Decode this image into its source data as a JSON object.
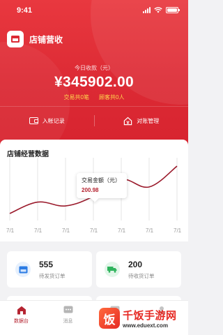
{
  "status_bar": {
    "time": "9:41"
  },
  "header": {
    "store_title": "店铺营收"
  },
  "revenue": {
    "label": "今日收款（元）",
    "amount": "¥345902.00",
    "transactions": "交易共0笔",
    "customers": "顾客共0人"
  },
  "actions": {
    "entry_records": "入帐记录",
    "reconcile": "对账管理"
  },
  "chart": {
    "title": "店铺经营数据",
    "tooltip_label": "交易金额（元）",
    "tooltip_value": "200.98",
    "x_labels": [
      "7/1",
      "7/1",
      "7/1",
      "7/1",
      "7/1",
      "7/1",
      "7/1"
    ]
  },
  "chart_data": {
    "type": "line",
    "title": "店铺经营数据",
    "categories": [
      "7/1",
      "7/1",
      "7/1",
      "7/1",
      "7/1",
      "7/1",
      "7/1"
    ],
    "values": [
      30,
      90,
      70,
      120,
      210,
      170,
      280
    ],
    "highlight": {
      "index": 3,
      "label": "交易金额（元）",
      "value": "200.98"
    },
    "grid": true,
    "line_color": "#9b1b2c"
  },
  "stats": [
    {
      "value": "555",
      "label": "待发货订单",
      "icon": "storefront-icon",
      "color": "#2a7be4",
      "bg": "#e6f0fd"
    },
    {
      "value": "200",
      "label": "待收货订单",
      "icon": "truck-icon",
      "color": "#2fb45d",
      "bg": "#e2f6e9"
    }
  ],
  "tabs": [
    {
      "label": "数据台",
      "icon": "home-icon",
      "active": true
    },
    {
      "label": "消息",
      "icon": "message-icon",
      "active": false
    },
    {
      "label": "",
      "icon": "chart-icon",
      "active": false
    },
    {
      "label": "",
      "icon": "user-icon",
      "active": false
    }
  ],
  "watermark": {
    "logo_char": "饭",
    "name": "千饭手游网",
    "url": "www.eduext.com"
  },
  "colors": {
    "brand_red": "#dc2a34",
    "accent_yellow": "#ffd84d"
  }
}
